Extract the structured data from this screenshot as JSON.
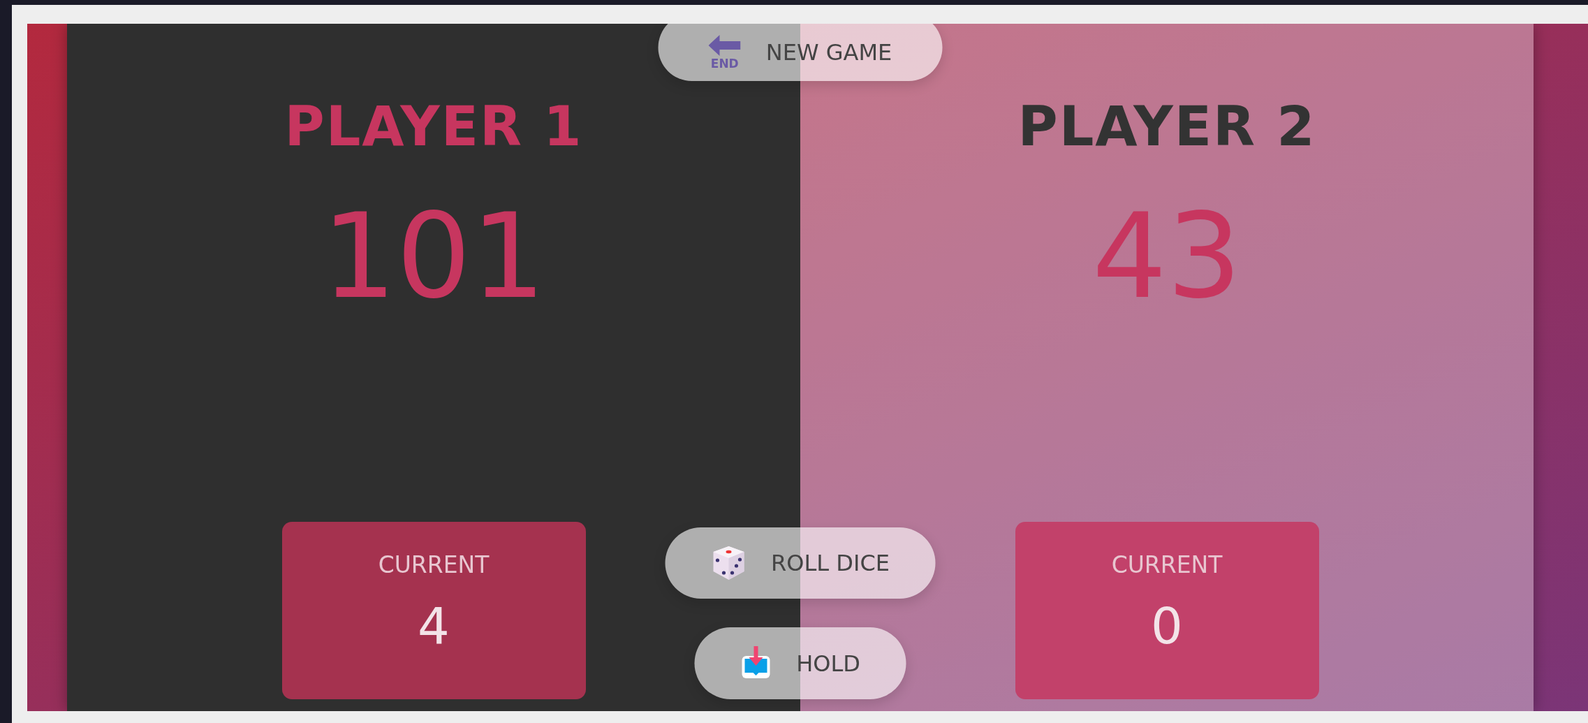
{
  "players": [
    {
      "name": "PLAYER 1",
      "score": "101",
      "current_label": "CURRENT",
      "current": "4",
      "active": true
    },
    {
      "name": "PLAYER 2",
      "score": "43",
      "current_label": "CURRENT",
      "current": "0",
      "active": false
    }
  ],
  "buttons": [
    {
      "kind": "new",
      "label": "NEW GAME",
      "icon_text": "END"
    },
    {
      "kind": "roll",
      "label": "ROLL DICE"
    },
    {
      "kind": "hold",
      "label": "HOLD"
    }
  ]
}
